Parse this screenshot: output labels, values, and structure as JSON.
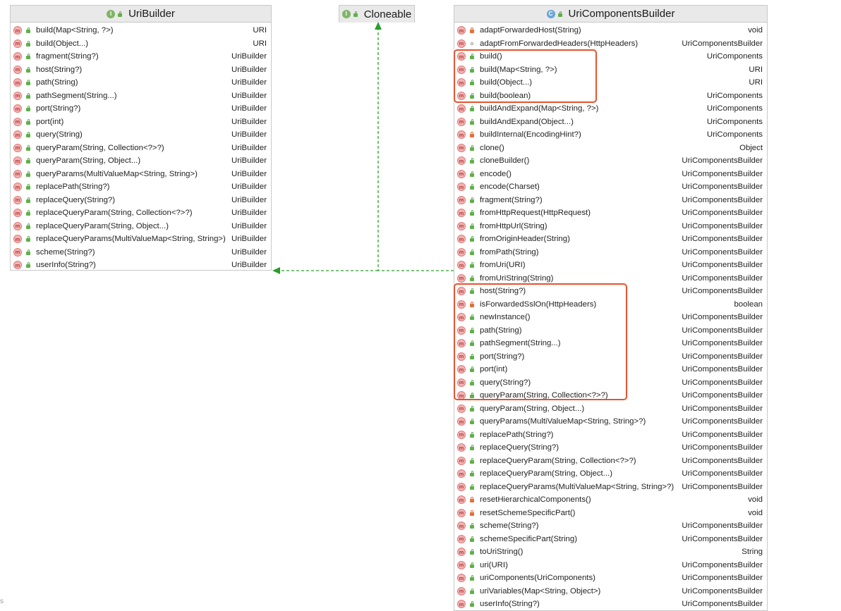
{
  "classes": {
    "uribuilder": {
      "name": "UriBuilder",
      "kind_badge": "I",
      "members": [
        {
          "sig": "build(Map<String, ?>)",
          "ret": "URI",
          "vis": "public"
        },
        {
          "sig": "build(Object...)",
          "ret": "URI",
          "vis": "public"
        },
        {
          "sig": "fragment(String?)",
          "ret": "UriBuilder",
          "vis": "public"
        },
        {
          "sig": "host(String?)",
          "ret": "UriBuilder",
          "vis": "public"
        },
        {
          "sig": "path(String)",
          "ret": "UriBuilder",
          "vis": "public"
        },
        {
          "sig": "pathSegment(String...)",
          "ret": "UriBuilder",
          "vis": "public"
        },
        {
          "sig": "port(String?)",
          "ret": "UriBuilder",
          "vis": "public"
        },
        {
          "sig": "port(int)",
          "ret": "UriBuilder",
          "vis": "public"
        },
        {
          "sig": "query(String)",
          "ret": "UriBuilder",
          "vis": "public"
        },
        {
          "sig": "queryParam(String, Collection<?>?)",
          "ret": "UriBuilder",
          "vis": "public"
        },
        {
          "sig": "queryParam(String, Object...)",
          "ret": "UriBuilder",
          "vis": "public"
        },
        {
          "sig": "queryParams(MultiValueMap<String, String>)",
          "ret": "UriBuilder",
          "vis": "public"
        },
        {
          "sig": "replacePath(String?)",
          "ret": "UriBuilder",
          "vis": "public"
        },
        {
          "sig": "replaceQuery(String?)",
          "ret": "UriBuilder",
          "vis": "public"
        },
        {
          "sig": "replaceQueryParam(String, Collection<?>?)",
          "ret": "UriBuilder",
          "vis": "public"
        },
        {
          "sig": "replaceQueryParam(String, Object...)",
          "ret": "UriBuilder",
          "vis": "public"
        },
        {
          "sig": "replaceQueryParams(MultiValueMap<String, String>)",
          "ret": "UriBuilder",
          "vis": "public"
        },
        {
          "sig": "scheme(String?)",
          "ret": "UriBuilder",
          "vis": "public"
        },
        {
          "sig": "userInfo(String?)",
          "ret": "UriBuilder",
          "vis": "public"
        }
      ]
    },
    "cloneable": {
      "name": "Cloneable",
      "kind_badge": "I",
      "members": []
    },
    "uricomponentsbuilder": {
      "name": "UriComponentsBuilder",
      "kind_badge": "C",
      "members": [
        {
          "sig": "adaptForwardedHost(String)",
          "ret": "void",
          "vis": "private"
        },
        {
          "sig": "adaptFromForwardedHeaders(HttpHeaders)",
          "ret": "UriComponentsBuilder",
          "vis": "package"
        },
        {
          "sig": "build()",
          "ret": "UriComponents",
          "vis": "public"
        },
        {
          "sig": "build(Map<String, ?>)",
          "ret": "URI",
          "vis": "public"
        },
        {
          "sig": "build(Object...)",
          "ret": "URI",
          "vis": "public"
        },
        {
          "sig": "build(boolean)",
          "ret": "UriComponents",
          "vis": "public"
        },
        {
          "sig": "buildAndExpand(Map<String, ?>)",
          "ret": "UriComponents",
          "vis": "public"
        },
        {
          "sig": "buildAndExpand(Object...)",
          "ret": "UriComponents",
          "vis": "public"
        },
        {
          "sig": "buildInternal(EncodingHint?)",
          "ret": "UriComponents",
          "vis": "private"
        },
        {
          "sig": "clone()",
          "ret": "Object",
          "vis": "public"
        },
        {
          "sig": "cloneBuilder()",
          "ret": "UriComponentsBuilder",
          "vis": "public"
        },
        {
          "sig": "encode()",
          "ret": "UriComponentsBuilder",
          "vis": "public"
        },
        {
          "sig": "encode(Charset)",
          "ret": "UriComponentsBuilder",
          "vis": "public"
        },
        {
          "sig": "fragment(String?)",
          "ret": "UriComponentsBuilder",
          "vis": "public"
        },
        {
          "sig": "fromHttpRequest(HttpRequest)",
          "ret": "UriComponentsBuilder",
          "vis": "public"
        },
        {
          "sig": "fromHttpUrl(String)",
          "ret": "UriComponentsBuilder",
          "vis": "public"
        },
        {
          "sig": "fromOriginHeader(String)",
          "ret": "UriComponentsBuilder",
          "vis": "public"
        },
        {
          "sig": "fromPath(String)",
          "ret": "UriComponentsBuilder",
          "vis": "public"
        },
        {
          "sig": "fromUri(URI)",
          "ret": "UriComponentsBuilder",
          "vis": "public"
        },
        {
          "sig": "fromUriString(String)",
          "ret": "UriComponentsBuilder",
          "vis": "public"
        },
        {
          "sig": "host(String?)",
          "ret": "UriComponentsBuilder",
          "vis": "public"
        },
        {
          "sig": "isForwardedSslOn(HttpHeaders)",
          "ret": "boolean",
          "vis": "private"
        },
        {
          "sig": "newInstance()",
          "ret": "UriComponentsBuilder",
          "vis": "public"
        },
        {
          "sig": "path(String)",
          "ret": "UriComponentsBuilder",
          "vis": "public"
        },
        {
          "sig": "pathSegment(String...)",
          "ret": "UriComponentsBuilder",
          "vis": "public"
        },
        {
          "sig": "port(String?)",
          "ret": "UriComponentsBuilder",
          "vis": "public"
        },
        {
          "sig": "port(int)",
          "ret": "UriComponentsBuilder",
          "vis": "public"
        },
        {
          "sig": "query(String?)",
          "ret": "UriComponentsBuilder",
          "vis": "public"
        },
        {
          "sig": "queryParam(String, Collection<?>?)",
          "ret": "UriComponentsBuilder",
          "vis": "public"
        },
        {
          "sig": "queryParam(String, Object...)",
          "ret": "UriComponentsBuilder",
          "vis": "public"
        },
        {
          "sig": "queryParams(MultiValueMap<String, String>?)",
          "ret": "UriComponentsBuilder",
          "vis": "public"
        },
        {
          "sig": "replacePath(String?)",
          "ret": "UriComponentsBuilder",
          "vis": "public"
        },
        {
          "sig": "replaceQuery(String?)",
          "ret": "UriComponentsBuilder",
          "vis": "public"
        },
        {
          "sig": "replaceQueryParam(String, Collection<?>?)",
          "ret": "UriComponentsBuilder",
          "vis": "public"
        },
        {
          "sig": "replaceQueryParam(String, Object...)",
          "ret": "UriComponentsBuilder",
          "vis": "public"
        },
        {
          "sig": "replaceQueryParams(MultiValueMap<String, String>?)",
          "ret": "UriComponentsBuilder",
          "vis": "public"
        },
        {
          "sig": "resetHierarchicalComponents()",
          "ret": "void",
          "vis": "private"
        },
        {
          "sig": "resetSchemeSpecificPart()",
          "ret": "void",
          "vis": "private"
        },
        {
          "sig": "scheme(String?)",
          "ret": "UriComponentsBuilder",
          "vis": "public"
        },
        {
          "sig": "schemeSpecificPart(String)",
          "ret": "UriComponentsBuilder",
          "vis": "public"
        },
        {
          "sig": "toUriString()",
          "ret": "String",
          "vis": "public"
        },
        {
          "sig": "uri(URI)",
          "ret": "UriComponentsBuilder",
          "vis": "public"
        },
        {
          "sig": "uriComponents(UriComponents)",
          "ret": "UriComponentsBuilder",
          "vis": "public"
        },
        {
          "sig": "uriVariables(Map<String, Object>)",
          "ret": "UriComponentsBuilder",
          "vis": "public"
        },
        {
          "sig": "userInfo(String?)",
          "ret": "UriComponentsBuilder",
          "vis": "public"
        }
      ]
    }
  },
  "method_badge": "m",
  "stray_text": "s",
  "colors": {
    "inheritance_arrow": "#2a9d2a",
    "highlight": "#e8522e"
  }
}
